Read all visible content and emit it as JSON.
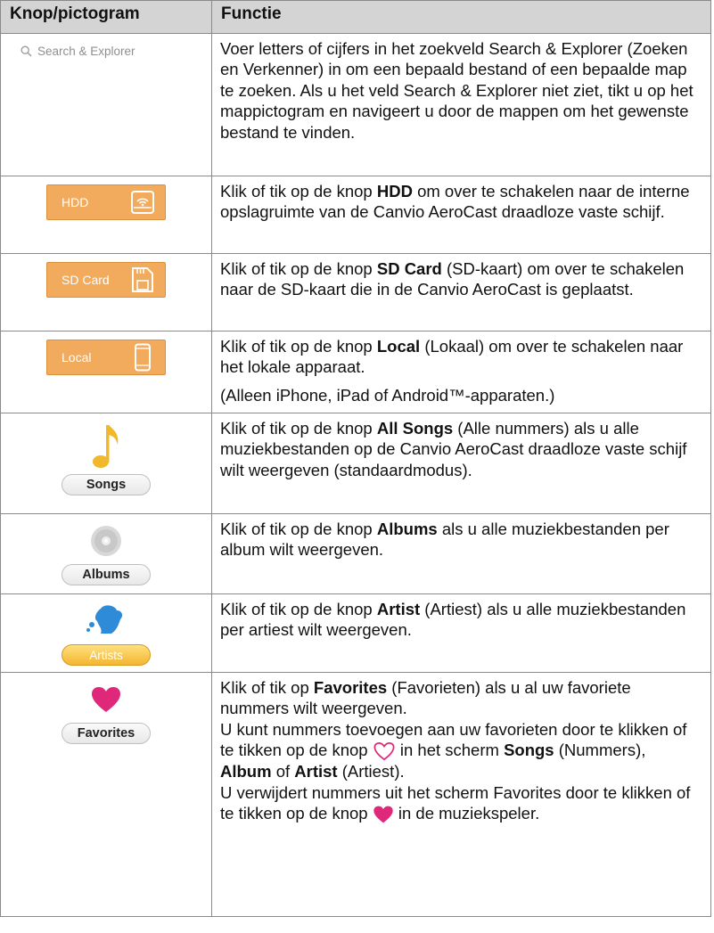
{
  "header": {
    "col1": "Knop/pictogram",
    "col2": "Functie"
  },
  "rows": {
    "search": {
      "icon_label": "Search & Explorer",
      "text": "Voer letters of cijfers in het zoekveld Search & Explorer (Zoeken en Verkenner) in om een bepaald bestand of een bepaalde map te zoeken. Als u het veld Search & Explorer niet ziet, tikt u op het mappictogram en navigeert u door de mappen om het gewenste bestand te vinden."
    },
    "hdd": {
      "icon_label": "HDD",
      "t1": "Klik of tik op de knop ",
      "b1": "HDD",
      "t2": " om over te schakelen naar de interne opslagruimte van de Canvio AeroCast draadloze vaste schijf."
    },
    "sd": {
      "icon_label": "SD Card",
      "t1": "Klik of tik op de knop ",
      "b1": "SD Card",
      "t2": " (SD-kaart) om over te schakelen naar de SD-kaart die in de Canvio AeroCast is geplaatst."
    },
    "local": {
      "icon_label": "Local",
      "t1": "Klik of tik op de knop ",
      "b1": "Local",
      "t2": " (Lokaal) om over te schakelen naar het lokale apparaat.",
      "note": "(Alleen iPhone, iPad of Android™-apparaten.)"
    },
    "songs": {
      "icon_label": "Songs",
      "t1": "Klik of tik op de knop ",
      "b1": "All Songs",
      "t2": " (Alle nummers) als u alle muziekbestanden op de Canvio AeroCast draadloze vaste schijf wilt weergeven (standaardmodus)."
    },
    "albums": {
      "icon_label": "Albums",
      "t1": "Klik of tik op de knop ",
      "b1": "Albums",
      "t2": " als u alle muziekbestanden per album wilt weergeven."
    },
    "artists": {
      "icon_label": "Artists",
      "t1": "Klik of tik op de knop ",
      "b1": "Artist",
      "t2": " (Artiest) als u alle muziekbestanden per artiest wilt weergeven."
    },
    "favorites": {
      "icon_label": "Favorites",
      "t1": "Klik of tik op ",
      "b1": "Favorites",
      "t2": " (Favorieten) als u al uw favoriete nummers wilt weergeven.",
      "t3": "U kunt nummers toevoegen aan uw favorieten door te klikken of te tikken op de knop ",
      "t4": " in het scherm ",
      "b2": "Songs",
      "t5": " (Nummers), ",
      "b3": "Album",
      "t6": " of ",
      "b4": "Artist",
      "t7": " (Artiest).",
      "t8": "U verwijdert nummers uit het scherm Favorites door te klikken of te tikken op de knop ",
      "t9": " in de muziekspeler."
    }
  },
  "colors": {
    "orange": "#f2aa5c",
    "heart": "#e0287a",
    "header_bg": "#d4d4d4",
    "note_gold": "#f0b82a"
  },
  "icons": [
    "search-icon",
    "wifi-drive-icon",
    "sd-card-icon",
    "phone-icon",
    "music-note-icon",
    "disc-icon",
    "artist-icon",
    "heart-icon",
    "heart-outline-icon"
  ]
}
